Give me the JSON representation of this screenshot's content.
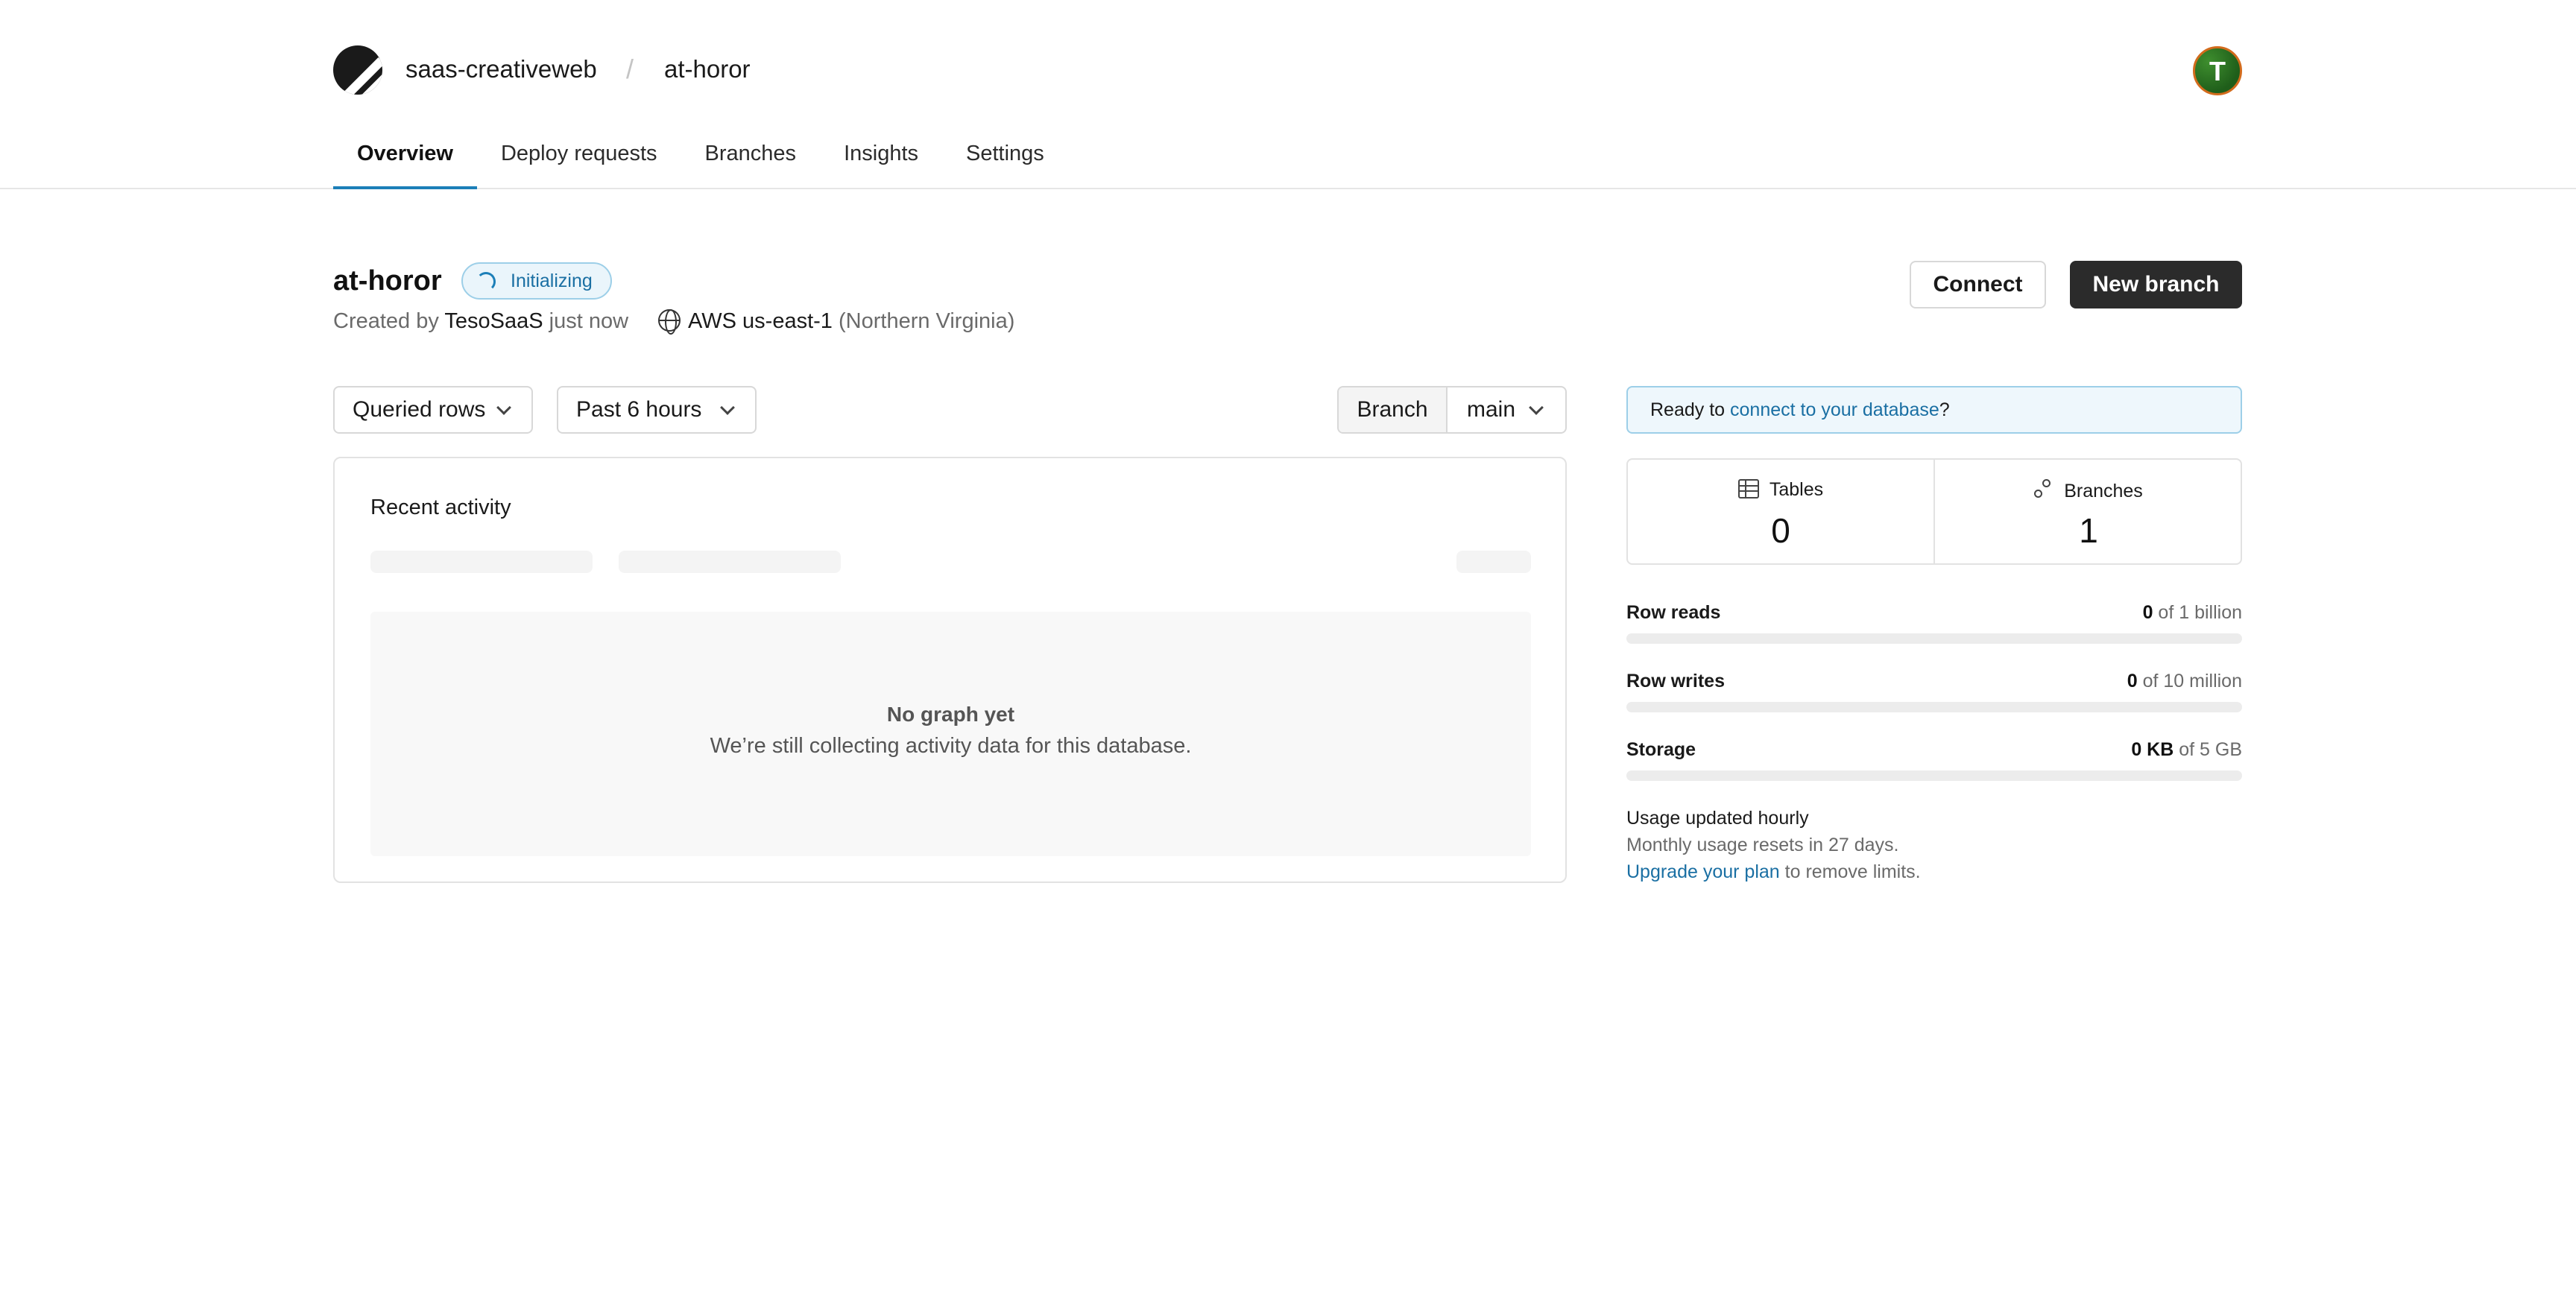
{
  "header": {
    "org_name": "saas-creativeweb",
    "separator": "/",
    "database_name": "at-horor",
    "avatar_initial": "T"
  },
  "tabs": [
    {
      "label": "Overview",
      "active": true
    },
    {
      "label": "Deploy requests",
      "active": false
    },
    {
      "label": "Branches",
      "active": false
    },
    {
      "label": "Insights",
      "active": false
    },
    {
      "label": "Settings",
      "active": false
    }
  ],
  "database": {
    "title": "at-horor",
    "status": "Initializing",
    "created_prefix": "Created by",
    "created_by": "TesoSaaS",
    "created_when": "just now",
    "region": "AWS us-east-1",
    "region_detail": "(Northern Virginia)"
  },
  "actions": {
    "connect_label": "Connect",
    "new_branch_label": "New branch"
  },
  "filters": {
    "metric": "Queried rows",
    "range": "Past 6 hours",
    "branch_label": "Branch",
    "branch_value": "main"
  },
  "activity": {
    "title": "Recent activity",
    "empty_title": "No graph yet",
    "empty_message": "We’re still collecting activity data for this database."
  },
  "connect_banner": {
    "prefix": "Ready to ",
    "link": "connect to your database",
    "suffix": "?"
  },
  "stats": {
    "tables_label": "Tables",
    "tables_value": "0",
    "branches_label": "Branches",
    "branches_value": "1"
  },
  "usage": [
    {
      "label": "Row reads",
      "value": "0",
      "limit": "of 1 billion",
      "fraction": 0
    },
    {
      "label": "Row writes",
      "value": "0",
      "limit": "of 10 million",
      "fraction": 0
    },
    {
      "label": "Storage",
      "value": "0 KB",
      "limit": "of 5 GB",
      "fraction": 0
    }
  ],
  "usage_note": {
    "title": "Usage updated hourly",
    "reset": "Monthly usage resets in 27 days.",
    "upgrade_link": "Upgrade your plan",
    "upgrade_suffix": " to remove limits."
  },
  "colors": {
    "accent": "#1c7fb8",
    "primary_button": "#2b2b2b",
    "banner_bg": "#eef7fc"
  }
}
